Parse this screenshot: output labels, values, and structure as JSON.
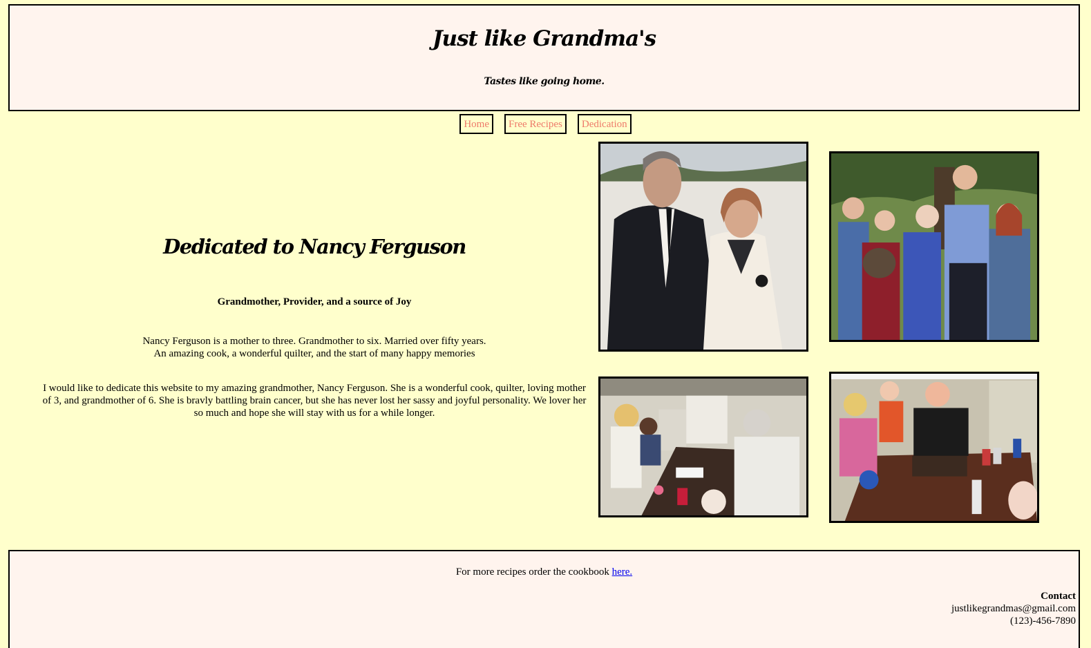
{
  "header": {
    "title": "Just like Grandma's",
    "tagline": "Tastes like going home."
  },
  "nav": {
    "items": [
      "Home",
      "Free Recipes",
      "Dedication"
    ]
  },
  "main": {
    "title": "Dedicated to Nancy Ferguson",
    "subtitle": "Grandmother, Provider, and a source of Joy",
    "summary_line1": "Nancy Ferguson is a mother to three. Grandmother to six. Married over fifty years.",
    "summary_line2": "An amazing cook, a wonderful quilter, and the start of many happy memories",
    "paragraph": "I would like to dedicate this website to my amazing grandmother, Nancy Ferguson. She is a wonderful cook, quilter, loving mother of 3, and grandmother of 6. She is bravly battling brain cancer, but she has never lost her sassy and joyful personality. We lover her so much and hope she will stay with us for a while longer."
  },
  "footer": {
    "cookbook_text": "For more recipes order the cookbook ",
    "cookbook_link": "here.",
    "contact_title": "Contact",
    "email": "justlikegrandmas@gmail.com",
    "phone": "(123)-456-7890"
  },
  "colors": {
    "page_background": "#ffffcc",
    "panel_background": "#fff4ee",
    "nav_link": "#ee7a6a",
    "link": "#0000ee"
  }
}
